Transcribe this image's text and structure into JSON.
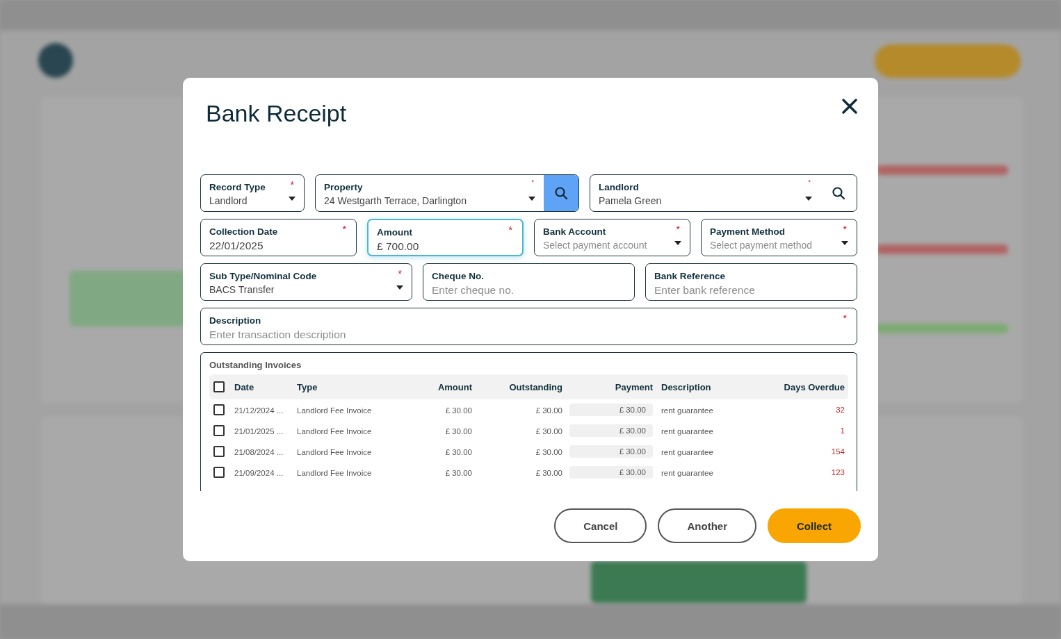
{
  "dialog": {
    "title": "Bank Receipt"
  },
  "form_rows": [
    [
      {
        "kind": "select",
        "label_text": "Record Type",
        "value": "Landlord",
        "required_mark": "*",
        "focused": false
      },
      {
        "kind": "select-search-button",
        "label_text": "Property",
        "value": "24 Westgarth Terrace, Darlington",
        "required_mark": "*",
        "focused": false
      },
      {
        "kind": "select-search",
        "label_text": "Landlord",
        "value": "Pamela Green",
        "required_mark": "*",
        "focused": false
      }
    ],
    [
      {
        "kind": "text",
        "label_text": "Collection Date",
        "value": "22/01/2025",
        "required_mark": "*",
        "focused": false
      },
      {
        "kind": "text",
        "label_text": "Amount",
        "value": "£ 700.00",
        "required_mark": "*",
        "focused": true
      },
      {
        "kind": "select",
        "label_text": "Bank Account",
        "placeholder": "Select payment account",
        "required_mark": "*",
        "focused": false
      },
      {
        "kind": "select",
        "label_text": "Payment Method",
        "placeholder": "Select payment method",
        "required_mark": "*",
        "focused": false
      }
    ],
    [
      {
        "kind": "select",
        "label_text": "Sub Type/Nominal Code",
        "value": "BACS Transfer",
        "required_mark": "*",
        "focused": false
      },
      {
        "kind": "text",
        "label_text": "Cheque No.",
        "placeholder": "Enter cheque no.",
        "focused": false
      },
      {
        "kind": "text",
        "label_text": "Bank Reference",
        "placeholder": "Enter bank reference",
        "focused": false
      }
    ],
    [
      {
        "kind": "text",
        "label_text": "Description",
        "placeholder": "Enter transaction description",
        "required_mark": "*",
        "focused": false
      }
    ]
  ],
  "invoices": {
    "title": "Outstanding Invoices",
    "select_all_checked": false,
    "columns": [
      "Date",
      "Type",
      "Amount",
      "Outstanding",
      "Payment",
      "Description",
      "Days Overdue"
    ],
    "rows": [
      {
        "checked": false,
        "date": "21/12/2024 ...",
        "type": "Landlord Fee Invoice",
        "amount": "£ 30.00",
        "outstanding": "£ 30.00",
        "payment": "£ 30.00",
        "description": "rent guarantee",
        "days_overdue": "32"
      },
      {
        "checked": false,
        "date": "21/01/2025 ...",
        "type": "Landlord Fee Invoice",
        "amount": "£ 30.00",
        "outstanding": "£ 30.00",
        "payment": "£ 30.00",
        "description": "rent guarantee",
        "days_overdue": "1"
      },
      {
        "checked": false,
        "date": "21/08/2024 ...",
        "type": "Landlord Fee Invoice",
        "amount": "£ 30.00",
        "outstanding": "£ 30.00",
        "payment": "£ 30.00",
        "description": "rent guarantee",
        "days_overdue": "154"
      },
      {
        "checked": false,
        "date": "21/09/2024 ...",
        "type": "Landlord Fee Invoice",
        "amount": "£ 30.00",
        "outstanding": "£ 30.00",
        "payment": "£ 30.00",
        "description": "rent guarantee",
        "days_overdue": "123"
      }
    ]
  },
  "buttons": [
    {
      "kind": "secondary",
      "label": "Cancel"
    },
    {
      "kind": "secondary",
      "label": "Another"
    },
    {
      "kind": "primary",
      "label": "Collect"
    }
  ]
}
